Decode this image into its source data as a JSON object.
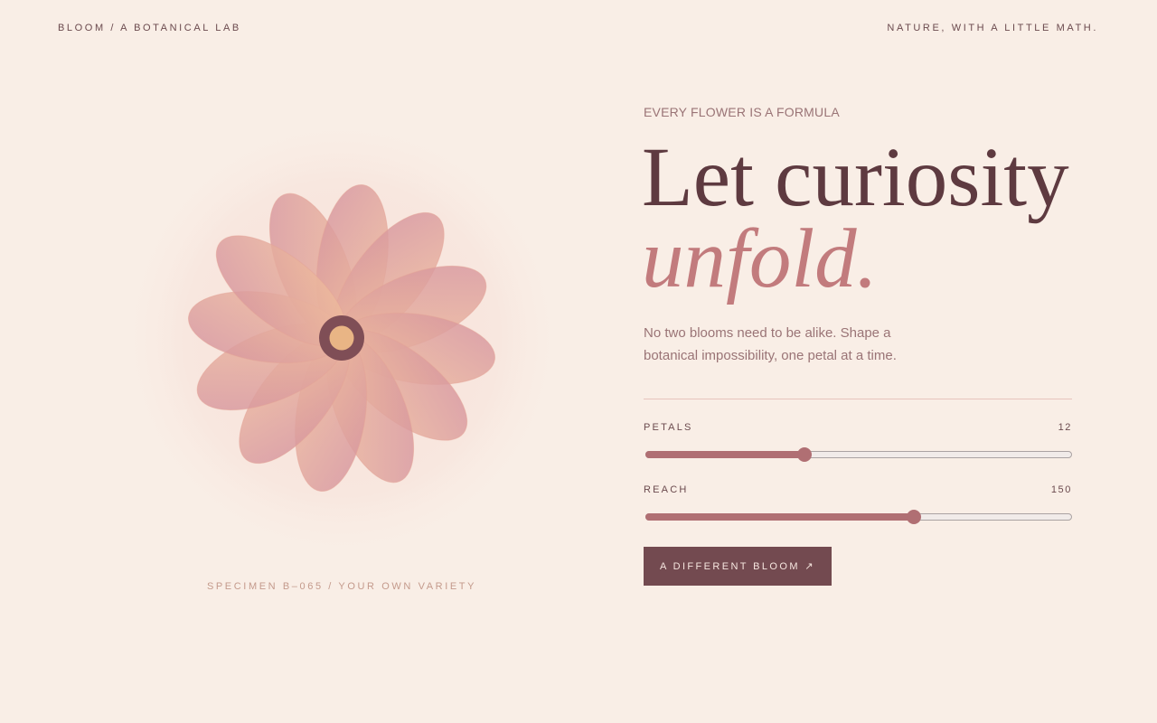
{
  "header": {
    "brand": "BLOOM / A BOTANICAL LAB",
    "tagline": "NATURE, WITH A LITTLE MATH."
  },
  "specimen_caption": "SPECIMEN B–065 / YOUR OWN VARIETY",
  "hero": {
    "eyebrow": "EVERY FLOWER IS A FORMULA",
    "headline_line1": "Let curiosity",
    "headline_line2": "unfold.",
    "description": "No two blooms need to be alike. Shape a botanical impossibility, one petal at a time."
  },
  "controls": {
    "petals": {
      "label": "PETALS",
      "value": "12",
      "fraction": 0.372
    },
    "reach": {
      "label": "REACH",
      "value": "150",
      "fraction": 0.63
    }
  },
  "button": {
    "label": "A DIFFERENT BLOOM ↗"
  },
  "flower": {
    "petal_count": 12
  },
  "colors": {
    "background": "#f9eee6",
    "accent": "#c27b7d",
    "deep": "#734a50",
    "petal_light": "#f1c09c",
    "petal_rose": "#d4919e",
    "center_ring": "#7f4e56",
    "center": "#e9b585"
  }
}
